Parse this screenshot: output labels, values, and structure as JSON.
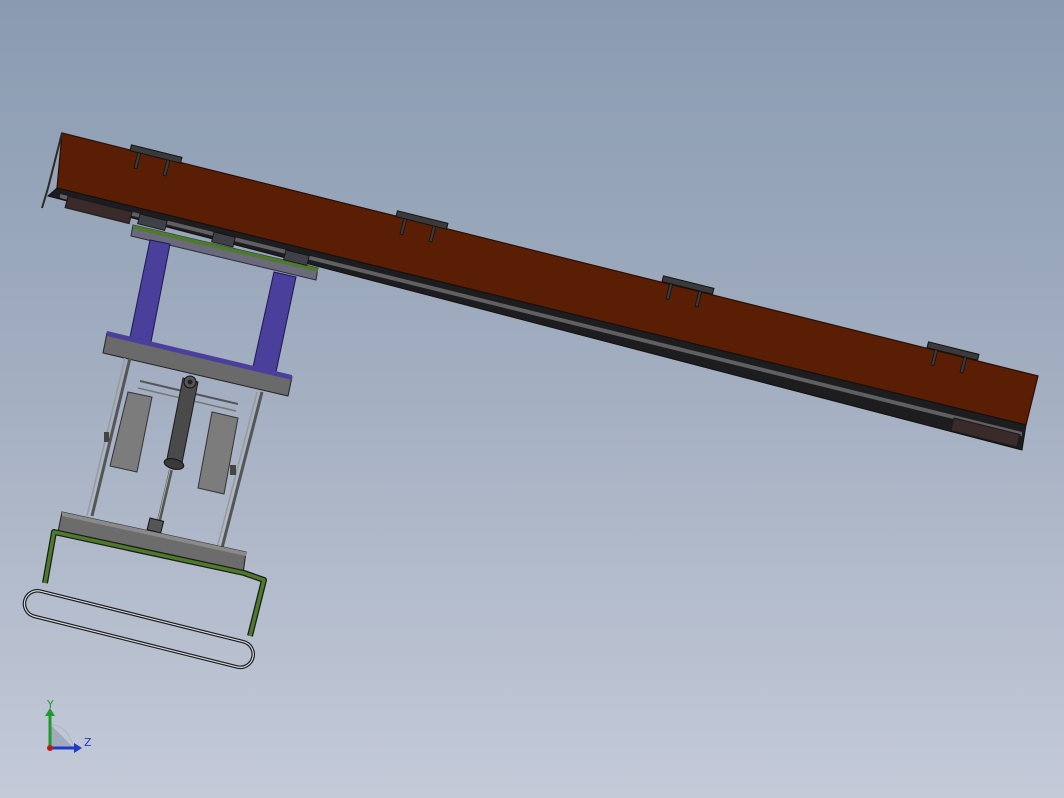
{
  "viewport": {
    "background_top": "#8a9bb1",
    "background_bottom": "#c4cad8"
  },
  "model": {
    "boom_color": "#5a1e05",
    "frame_color": "#4a3f9a",
    "base_frame_color": "#4e7a2c",
    "steel_color": "#7a7a7a",
    "clamp_count": 4
  },
  "triad": {
    "y_label": "Y",
    "z_label": "Z",
    "y_color": "#1e9a28",
    "z_color": "#1c3cc8"
  }
}
